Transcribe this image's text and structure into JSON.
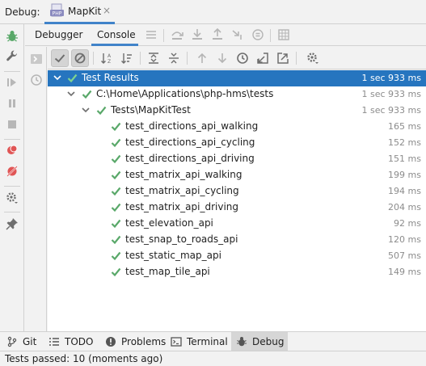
{
  "titlebar": {
    "debug_label": "Debug:",
    "session_name": "MapKit",
    "close_glyph": "×",
    "session_icon": "php-file-icon"
  },
  "tabs": {
    "debugger": "Debugger",
    "console": "Console",
    "active": "console"
  },
  "tree": {
    "root": {
      "label": "Test Results",
      "duration": "1 sec 933 ms"
    },
    "path": {
      "label": "C:\\Home\\Applications\\php-hms\\tests",
      "duration": "1 sec 933 ms"
    },
    "suite": {
      "label": "Tests\\MapKitTest",
      "duration": "1 sec 933 ms"
    },
    "tests": [
      {
        "label": "test_directions_api_walking",
        "duration": "165 ms"
      },
      {
        "label": "test_directions_api_cycling",
        "duration": "152 ms"
      },
      {
        "label": "test_directions_api_driving",
        "duration": "151 ms"
      },
      {
        "label": "test_matrix_api_walking",
        "duration": "199 ms"
      },
      {
        "label": "test_matrix_api_cycling",
        "duration": "194 ms"
      },
      {
        "label": "test_matrix_api_driving",
        "duration": "204 ms"
      },
      {
        "label": "test_elevation_api",
        "duration": "92 ms"
      },
      {
        "label": "test_snap_to_roads_api",
        "duration": "120 ms"
      },
      {
        "label": "test_static_map_api",
        "duration": "507 ms"
      },
      {
        "label": "test_map_tile_api",
        "duration": "149 ms"
      }
    ]
  },
  "bottom_tabs": {
    "git": "Git",
    "todo": "TODO",
    "problems": "Problems",
    "terminal": "Terminal",
    "debug": "Debug",
    "active": "debug"
  },
  "status": {
    "text": "Tests passed: 10 (moments ago)"
  },
  "colors": {
    "accent": "#4083c9",
    "selection": "#2675bf",
    "pass_green": "#59a869",
    "debug_green": "#59a869",
    "breakpoint_red": "#e05555"
  }
}
